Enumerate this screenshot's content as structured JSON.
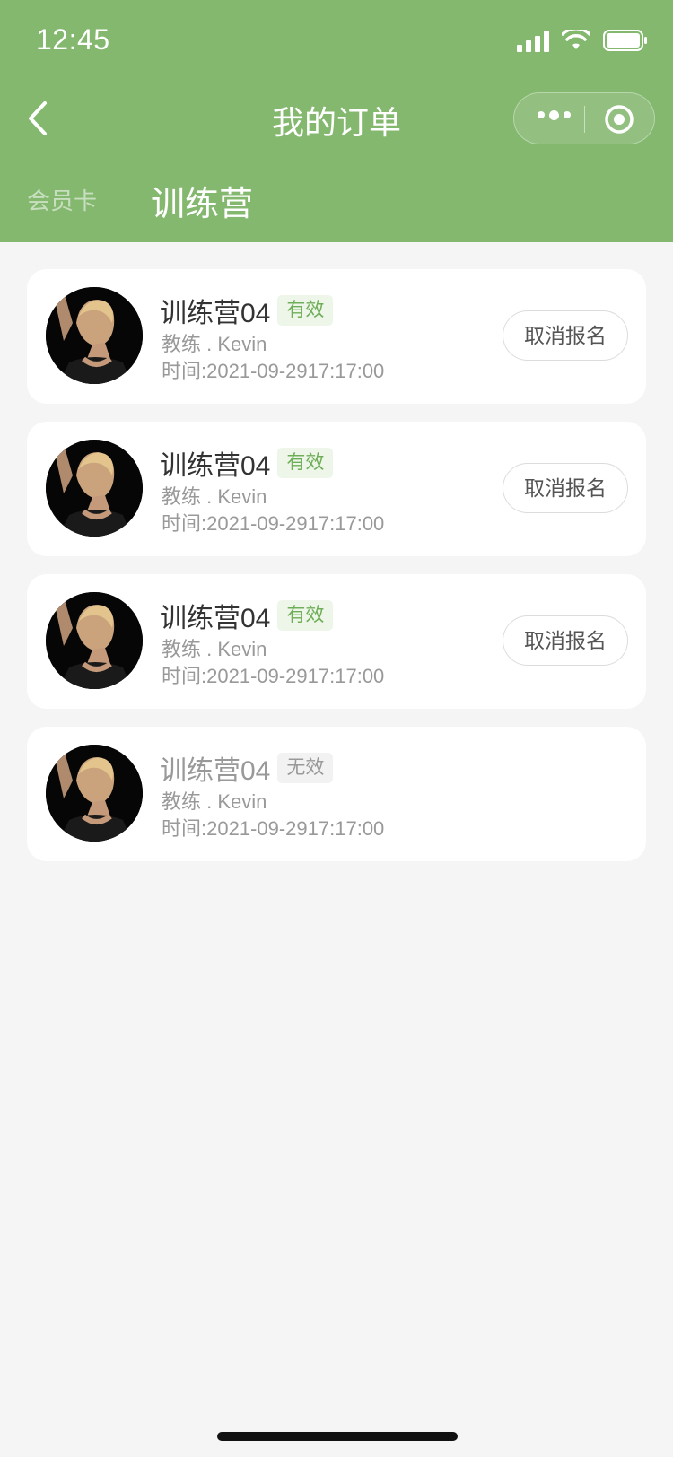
{
  "status_bar": {
    "time": "12:45"
  },
  "nav": {
    "title": "我的订单"
  },
  "tabs": [
    {
      "label": "会员卡",
      "active": false
    },
    {
      "label": "训练营",
      "active": true
    }
  ],
  "orders": [
    {
      "title": "训练营04",
      "status": "有效",
      "coach": "教练 . Kevin",
      "time": "时间:2021-09-2917:17:00",
      "action": "取消报名"
    },
    {
      "title": "训练营04",
      "status": "有效",
      "coach": "教练 . Kevin",
      "time": "时间:2021-09-2917:17:00",
      "action": "取消报名"
    },
    {
      "title": "训练营04",
      "status": "有效",
      "coach": "教练 . Kevin",
      "time": "时间:2021-09-2917:17:00",
      "action": "取消报名"
    },
    {
      "title": "训练营04",
      "status": "无效",
      "coach": "教练 . Kevin",
      "time": "时间:2021-09-2917:17:00"
    }
  ],
  "colors": {
    "header": "#84b86f",
    "valid": "#6fae58",
    "background": "#f5f5f5"
  }
}
